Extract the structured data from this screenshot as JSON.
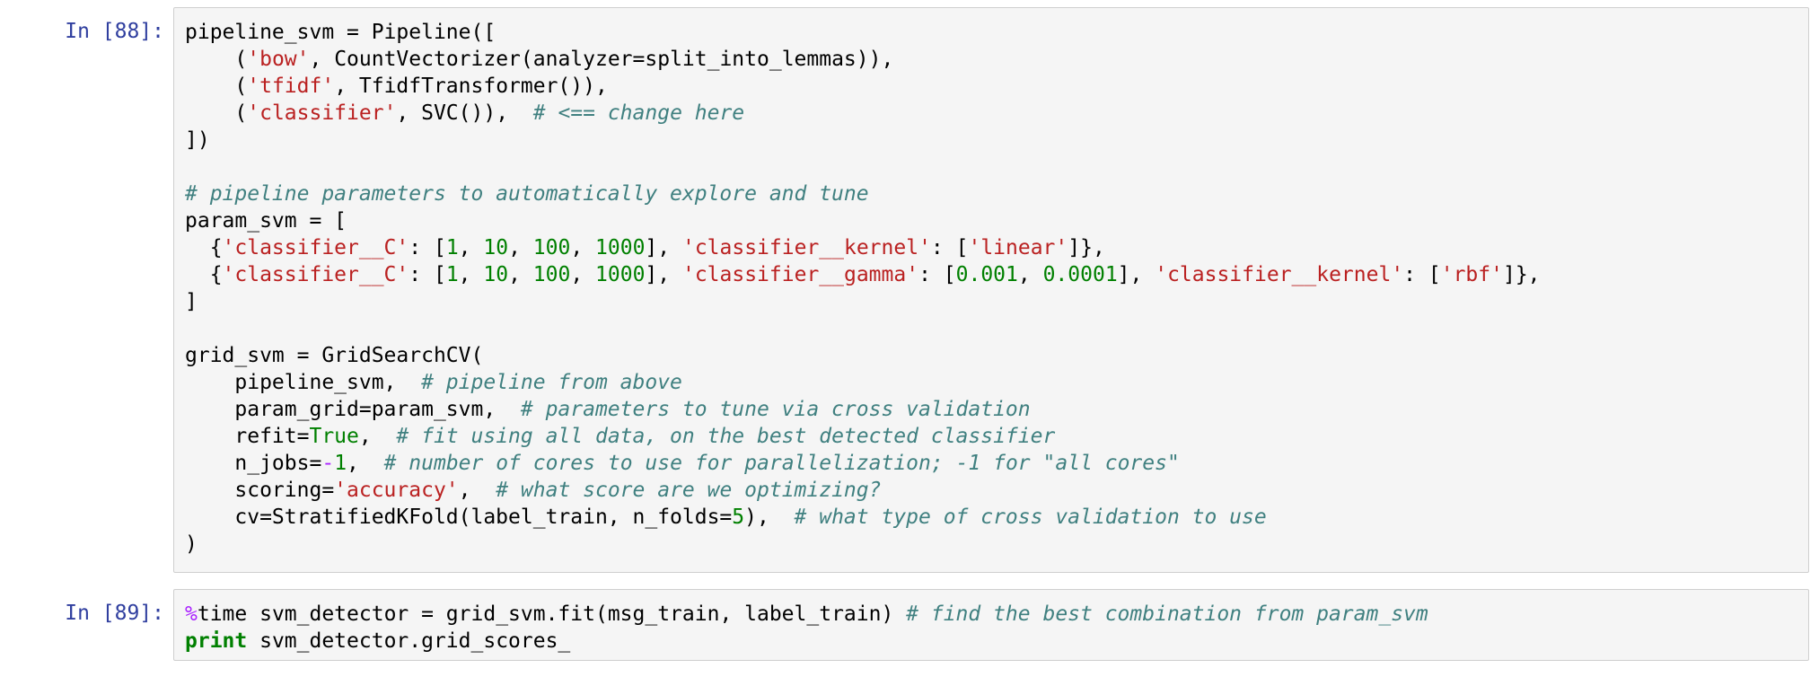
{
  "cells": [
    {
      "prompt": "In [88]:",
      "lines": [
        [
          {
            "t": "pipeline_svm = Pipeline([",
            "k": "plain"
          }
        ],
        [
          {
            "t": "    (",
            "k": "plain"
          },
          {
            "t": "'bow'",
            "k": "str"
          },
          {
            "t": ", CountVectorizer(analyzer=split_into_lemmas)),",
            "k": "plain"
          }
        ],
        [
          {
            "t": "    (",
            "k": "plain"
          },
          {
            "t": "'tfidf'",
            "k": "str"
          },
          {
            "t": ", TfidfTransformer()),",
            "k": "plain"
          }
        ],
        [
          {
            "t": "    (",
            "k": "plain"
          },
          {
            "t": "'classifier'",
            "k": "str"
          },
          {
            "t": ", SVC()),  ",
            "k": "plain"
          },
          {
            "t": "# <== change here",
            "k": "cm"
          }
        ],
        [
          {
            "t": "])",
            "k": "plain"
          }
        ],
        [],
        [
          {
            "t": "# pipeline parameters to automatically explore and tune",
            "k": "cm"
          }
        ],
        [
          {
            "t": "param_svm = [",
            "k": "plain"
          }
        ],
        [
          {
            "t": "  {",
            "k": "plain"
          },
          {
            "t": "'classifier__C'",
            "k": "str"
          },
          {
            "t": ": [",
            "k": "plain"
          },
          {
            "t": "1",
            "k": "num"
          },
          {
            "t": ", ",
            "k": "plain"
          },
          {
            "t": "10",
            "k": "num"
          },
          {
            "t": ", ",
            "k": "plain"
          },
          {
            "t": "100",
            "k": "num"
          },
          {
            "t": ", ",
            "k": "plain"
          },
          {
            "t": "1000",
            "k": "num"
          },
          {
            "t": "], ",
            "k": "plain"
          },
          {
            "t": "'classifier__kernel'",
            "k": "str"
          },
          {
            "t": ": [",
            "k": "plain"
          },
          {
            "t": "'linear'",
            "k": "str"
          },
          {
            "t": "]},",
            "k": "plain"
          }
        ],
        [
          {
            "t": "  {",
            "k": "plain"
          },
          {
            "t": "'classifier__C'",
            "k": "str"
          },
          {
            "t": ": [",
            "k": "plain"
          },
          {
            "t": "1",
            "k": "num"
          },
          {
            "t": ", ",
            "k": "plain"
          },
          {
            "t": "10",
            "k": "num"
          },
          {
            "t": ", ",
            "k": "plain"
          },
          {
            "t": "100",
            "k": "num"
          },
          {
            "t": ", ",
            "k": "plain"
          },
          {
            "t": "1000",
            "k": "num"
          },
          {
            "t": "], ",
            "k": "plain"
          },
          {
            "t": "'classifier__gamma'",
            "k": "str"
          },
          {
            "t": ": [",
            "k": "plain"
          },
          {
            "t": "0.001",
            "k": "num"
          },
          {
            "t": ", ",
            "k": "plain"
          },
          {
            "t": "0.0001",
            "k": "num"
          },
          {
            "t": "], ",
            "k": "plain"
          },
          {
            "t": "'classifier__kernel'",
            "k": "str"
          },
          {
            "t": ": [",
            "k": "plain"
          },
          {
            "t": "'rbf'",
            "k": "str"
          },
          {
            "t": "]},",
            "k": "plain"
          }
        ],
        [
          {
            "t": "]",
            "k": "plain"
          }
        ],
        [],
        [
          {
            "t": "grid_svm = GridSearchCV(",
            "k": "plain"
          }
        ],
        [
          {
            "t": "    pipeline_svm,  ",
            "k": "plain"
          },
          {
            "t": "# pipeline from above",
            "k": "cm"
          }
        ],
        [
          {
            "t": "    param_grid=param_svm,  ",
            "k": "plain"
          },
          {
            "t": "# parameters to tune via cross validation",
            "k": "cm"
          }
        ],
        [
          {
            "t": "    refit=",
            "k": "plain"
          },
          {
            "t": "True",
            "k": "num"
          },
          {
            "t": ",  ",
            "k": "plain"
          },
          {
            "t": "# fit using all data, on the best detected classifier",
            "k": "cm"
          }
        ],
        [
          {
            "t": "    n_jobs=",
            "k": "plain"
          },
          {
            "t": "-",
            "k": "op"
          },
          {
            "t": "1",
            "k": "num"
          },
          {
            "t": ",  ",
            "k": "plain"
          },
          {
            "t": "# number of cores to use for parallelization; -1 for \"all cores\"",
            "k": "cm"
          }
        ],
        [
          {
            "t": "    scoring=",
            "k": "plain"
          },
          {
            "t": "'accuracy'",
            "k": "str"
          },
          {
            "t": ",  ",
            "k": "plain"
          },
          {
            "t": "# what score are we optimizing?",
            "k": "cm"
          }
        ],
        [
          {
            "t": "    cv=StratifiedKFold(label_train, n_folds=",
            "k": "plain"
          },
          {
            "t": "5",
            "k": "num"
          },
          {
            "t": "),  ",
            "k": "plain"
          },
          {
            "t": "# what type of cross validation to use",
            "k": "cm"
          }
        ],
        [
          {
            "t": ")",
            "k": "plain"
          }
        ]
      ]
    },
    {
      "prompt": "In [89]:",
      "lines": [
        [
          {
            "t": "%",
            "k": "magic"
          },
          {
            "t": "time svm_detector = grid_svm.fit(msg_train, label_train) ",
            "k": "plain"
          },
          {
            "t": "# find the best combination from param_svm",
            "k": "cm"
          }
        ],
        [
          {
            "t": "print",
            "k": "kw"
          },
          {
            "t": " svm_detector.grid_scores_",
            "k": "plain"
          }
        ]
      ]
    }
  ]
}
